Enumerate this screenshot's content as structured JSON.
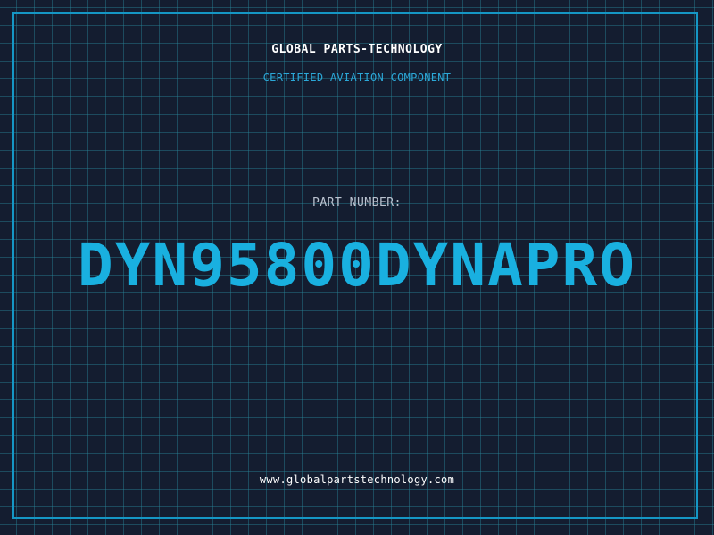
{
  "header": {
    "company": "GLOBAL PARTS-TECHNOLOGY",
    "subtitle": "CERTIFIED AVIATION COMPONENT"
  },
  "part": {
    "label": "PART NUMBER:",
    "number": "DYN95800DYNAPRO"
  },
  "footer": {
    "website": "www.globalpartstechnology.com"
  },
  "colors": {
    "background": "#141d30",
    "grid": "#28829a",
    "frame": "#1596c4",
    "accent": "#19b0e0",
    "text": "#ffffff"
  }
}
